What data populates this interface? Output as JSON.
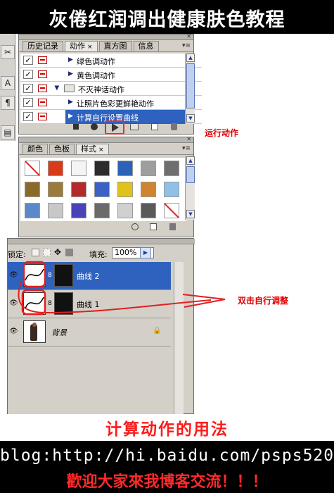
{
  "title": "灰倦红润调出健康肤色教程",
  "actions_panel": {
    "tabs": [
      "历史记录",
      "动作",
      "直方图",
      "信息"
    ],
    "tab_close": "×",
    "menu_glyph": "▾≡",
    "rows": [
      {
        "label": "绿色调动作",
        "checked": true,
        "selected": false,
        "folder": false
      },
      {
        "label": "黄色调动作",
        "checked": true,
        "selected": false,
        "folder": false
      },
      {
        "label": "不灭神话动作",
        "checked": true,
        "selected": false,
        "folder": true
      },
      {
        "label": "让照片色彩更鲜艳动作",
        "checked": true,
        "selected": false,
        "folder": false
      },
      {
        "label": "计算自行设置曲线",
        "checked": true,
        "selected": true,
        "folder": false
      }
    ],
    "play_annotation": "运行动作"
  },
  "styles_panel": {
    "tabs": [
      "颜色",
      "色板",
      "样式"
    ],
    "tab_close": "×",
    "swatch_colors": [
      [
        "#ffffff",
        "#d83a1a",
        "#f4f4f4",
        "#2c2c2c",
        "#2a63b8",
        "#9e9e9e",
        "#6f6f6f"
      ],
      [
        "#8a6a2a",
        "#9b7a3a",
        "#b42a2a",
        "#3a62c4",
        "#e0c21b",
        "#d08430",
        "#8fc1e8"
      ],
      [
        "#5b88c8",
        "#c8c8c8",
        "#4a42b8",
        "#6a6a6a",
        "#d0d0d0",
        "#5a5a5a",
        "#ffffff"
      ]
    ]
  },
  "layers_panel": {
    "lock_label": "锁定:",
    "fill_label": "填充:",
    "fill_value": "100%",
    "layers": [
      {
        "name": "曲线 2",
        "selected": true
      },
      {
        "name": "曲线 1",
        "selected": false
      },
      {
        "name": "背景",
        "selected": false
      }
    ],
    "annotation": "双击自行调整"
  },
  "footer": {
    "usage_title": "计算动作的用法",
    "blog_url": "blog:http://hi.baidu.com/psps520",
    "welcome": "歡迎大家來我博客交流！！！"
  }
}
